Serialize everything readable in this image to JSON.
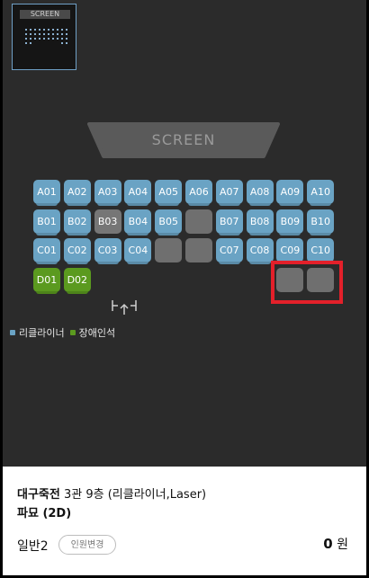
{
  "minimap": {
    "screen_label": "SCREEN"
  },
  "screen": {
    "label": "SCREEN"
  },
  "seat_rows": [
    [
      {
        "label": "A01",
        "type": "recliner"
      },
      {
        "label": "A02",
        "type": "recliner"
      },
      {
        "label": "A03",
        "type": "recliner"
      },
      {
        "label": "A04",
        "type": "recliner"
      },
      {
        "label": "A05",
        "type": "recliner"
      },
      {
        "label": "A06",
        "type": "recliner"
      },
      {
        "label": "A07",
        "type": "recliner"
      },
      {
        "label": "A08",
        "type": "recliner"
      },
      {
        "label": "A09",
        "type": "recliner"
      },
      {
        "label": "A10",
        "type": "recliner"
      }
    ],
    [
      {
        "label": "B01",
        "type": "recliner"
      },
      {
        "label": "B02",
        "type": "recliner"
      },
      {
        "label": "B03",
        "type": "taken"
      },
      {
        "label": "B04",
        "type": "recliner"
      },
      {
        "label": "B05",
        "type": "recliner"
      },
      {
        "label": "",
        "type": "blocked"
      },
      {
        "label": "B07",
        "type": "recliner"
      },
      {
        "label": "B08",
        "type": "recliner"
      },
      {
        "label": "B09",
        "type": "recliner"
      },
      {
        "label": "B10",
        "type": "recliner"
      }
    ],
    [
      {
        "label": "C01",
        "type": "recliner"
      },
      {
        "label": "C02",
        "type": "recliner"
      },
      {
        "label": "C03",
        "type": "recliner"
      },
      {
        "label": "C04",
        "type": "recliner"
      },
      {
        "label": "",
        "type": "blocked"
      },
      {
        "label": "",
        "type": "blocked"
      },
      {
        "label": "C07",
        "type": "recliner"
      },
      {
        "label": "C08",
        "type": "recliner"
      },
      {
        "label": "C09",
        "type": "recliner"
      },
      {
        "label": "C10",
        "type": "recliner"
      }
    ],
    [
      {
        "label": "D01",
        "type": "disabled"
      },
      {
        "label": "D02",
        "type": "disabled"
      },
      null,
      null,
      null,
      null,
      null,
      null,
      {
        "label": "",
        "type": "blocked"
      },
      {
        "label": "",
        "type": "blocked"
      }
    ]
  ],
  "legend": [
    {
      "label": "리클라이너",
      "color": "#6aa3c4"
    },
    {
      "label": "장애인석",
      "color": "#5b9a1f"
    }
  ],
  "booking": {
    "theater": "대구죽전",
    "hall_info": "3관 9층 (리클라이너,Laser)",
    "movie": "파묘 (2D)",
    "ticket_type": "일반2",
    "change_button": "인원변경",
    "price_amount": "0",
    "price_unit": "원"
  },
  "colors": {
    "background": "#2b2b2b",
    "recliner": "#6aa3c4",
    "disabled": "#5b9a1f",
    "taken": "#767676",
    "highlight": "#e3202a"
  }
}
